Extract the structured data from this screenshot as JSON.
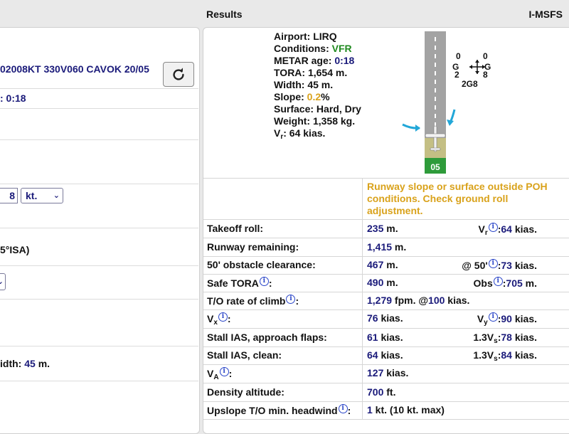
{
  "header": {
    "results_title": "Results",
    "brand": "I-MSFS"
  },
  "left": {
    "metar": "02008KT 330V060 CAVOK 20/05",
    "metar_age": ": 0:18",
    "wind_speed": "8",
    "wind_unit": "kt.",
    "isa_text": "5°ISA)",
    "width_label": "idth:",
    "width_value": "45",
    "width_unit": "m."
  },
  "summary": {
    "airport_label": "Airport:",
    "airport": "LIRQ",
    "conditions_label": "Conditions:",
    "conditions": "VFR",
    "metar_age_label": "METAR age:",
    "metar_age": "0:18",
    "tora_label": "TORA:",
    "tora": "1,654 m.",
    "width_label": "Width:",
    "width": "45 m.",
    "slope_label": "Slope:",
    "slope": "0.2",
    "slope_unit": "%",
    "surface_label": "Surface:",
    "surface": "Hard, Dry",
    "weight_label": "Weight:",
    "weight": "1,358 kg.",
    "vr_label_main": "V",
    "vr_label_sub": "r",
    "vr": ": 64 kias."
  },
  "runway": {
    "number": "05",
    "wind_top_left": "0",
    "wind_top_right": "0",
    "wind_mid_left": "G",
    "wind_mid_right": "G",
    "wind_bottom_left": "2",
    "wind_bottom_right": "8",
    "wind_center": "2G8"
  },
  "warning": "Runway slope or surface outside POH conditions. Check ground roll adjustment.",
  "rows": [
    {
      "label": "Takeoff roll:",
      "value": "235",
      "unit": " m.",
      "extra_pre": "V",
      "extra_sub": "r",
      "extra_val": "64",
      "extra_unit": " kias."
    },
    {
      "label": "Runway remaining:",
      "value": "1,415",
      "unit": " m."
    },
    {
      "label": "50' obstacle clearance:",
      "value": "467",
      "unit": " m.",
      "extra_pre": "@ 50'",
      "extra_val": "73",
      "extra_unit": " kias."
    },
    {
      "label": "Safe TORA",
      "value": "490",
      "unit": " m.",
      "extra_pre": "Obs",
      "extra_val": "705",
      "extra_unit": " m."
    },
    {
      "label": "T/O rate of climb",
      "value": "1,279",
      "unit": " fpm. @",
      "value2": "100",
      "unit2": " kias."
    },
    {
      "label_main": "V",
      "label_sub": "x",
      "value": "76",
      "unit": " kias.",
      "extra_pre": "V",
      "extra_sub": "y",
      "extra_val": "90",
      "extra_unit": " kias."
    },
    {
      "label": "Stall IAS, approach flaps:",
      "value": "61",
      "unit": " kias.",
      "extra_pre": "1.3V",
      "extra_sub": "s",
      "extra_val": "78",
      "extra_unit": " kias."
    },
    {
      "label": "Stall IAS, clean:",
      "value": "64",
      "unit": " kias.",
      "extra_pre": "1.3V",
      "extra_sub": "s",
      "extra_val": "84",
      "extra_unit": " kias."
    },
    {
      "label_main": "V",
      "label_sub": "A",
      "value": "127",
      "unit": " kias."
    },
    {
      "label": "Density altitude:",
      "value": "700",
      "unit": " ft."
    },
    {
      "label": "Upslope T/O min. headwind",
      "value": "1",
      "unit": " kt. (10 kt. max)"
    }
  ],
  "icons": {
    "info": "i",
    "refresh": "refresh-icon"
  }
}
